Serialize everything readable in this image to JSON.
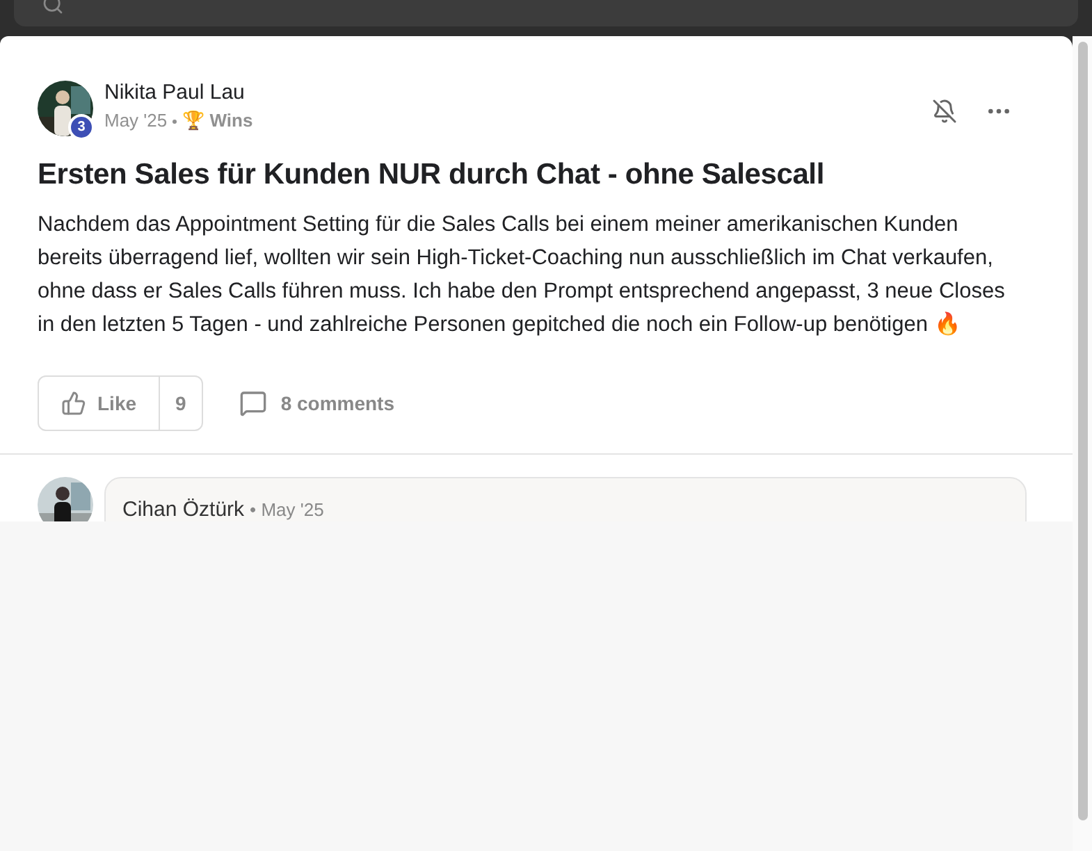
{
  "post": {
    "author": "Nikita Paul Lau",
    "level_badge": "3",
    "date": "May '25",
    "category_icon": "🏆",
    "category": "Wins",
    "title": "Ersten Sales für Kunden NUR durch Chat - ohne Salescall",
    "body": "Nachdem das Appointment Setting für die Sales Calls bei einem meiner amerikanischen Kunden bereits überragend lief, wollten wir sein High-Ticket-Coaching nun ausschließlich im Chat verkaufen, ohne dass er Sales Calls führen muss. Ich habe den Prompt entsprechend angepasst, 3 neue Closes in den letzten 5 Tagen - und zahlreiche Personen gepitched die noch ein Follow-up benötigen 🔥",
    "like_label": "Like",
    "like_count": "9",
    "comments_label": "8 comments"
  },
  "comments": [
    {
      "author": "Cihan Öztürk",
      "date": "• May '25"
    }
  ]
}
